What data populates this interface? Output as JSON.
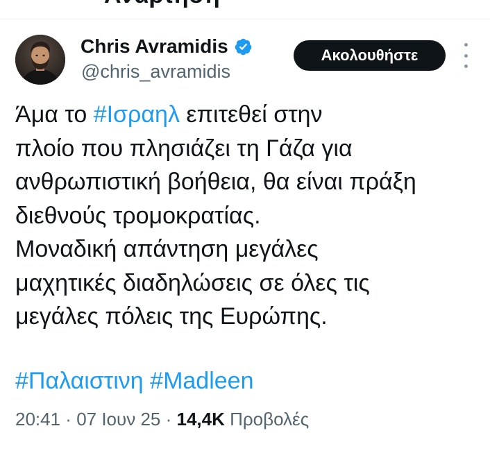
{
  "header": {
    "cut_title": "Ανάρτηση"
  },
  "author": {
    "display_name": "Chris Avramidis",
    "handle": "@chris_avramidis",
    "verified": true,
    "avatar_icon": "profile-photo"
  },
  "actions": {
    "follow_label": "Ακολουθήστε",
    "more_icon": "more-vertical-icon"
  },
  "tweet": {
    "lines": [
      {
        "before": "Άμα το ",
        "hashtag": "#Ισραηλ",
        "after": " επιτεθεί στην"
      },
      {
        "text": "πλοίο που πλησιάζει τη Γάζα για"
      },
      {
        "text": "ανθρωπιστική βοήθεια, θα είναι πράξη"
      },
      {
        "text": "διεθνούς τρομοκρατίας."
      },
      {
        "text": "Μοναδική απάντηση μεγάλες"
      },
      {
        "text": "μαχητικές διαδηλώσεις σε όλες τις"
      },
      {
        "text": "μεγάλες πόλεις της Ευρώπης."
      }
    ],
    "hashtags": [
      "#Παλαιστινη",
      "#Madleen"
    ]
  },
  "meta": {
    "time": "20:41",
    "separator": " · ",
    "date": "07 Ιουν 25",
    "views_count": "14,4K",
    "views_label": " Προβολές"
  },
  "colors": {
    "link": "#1d9bf0",
    "verified": "#1d9bf0",
    "secondary_text": "#536471",
    "button_bg": "#0f1419"
  }
}
